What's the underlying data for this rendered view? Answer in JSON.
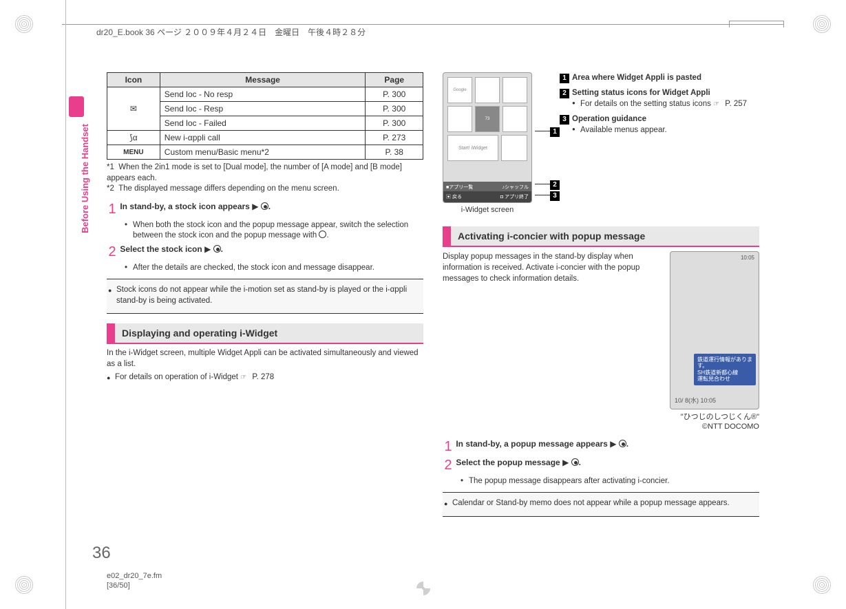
{
  "header": {
    "book_info": "dr20_E.book  36 ページ  ２００９年４月２４日　金曜日　午後４時２８分"
  },
  "side": {
    "tab_title": "Before Using the Handset"
  },
  "table": {
    "headers": {
      "icon": "Icon",
      "message": "Message",
      "page": "Page"
    },
    "rows": [
      {
        "icon": "✉",
        "message": "Send loc - No resp",
        "page": "P. 300"
      },
      {
        "icon": "",
        "message": "Send loc - Resp",
        "page": "P. 300"
      },
      {
        "icon": "",
        "message": "Send loc - Failed",
        "page": "P. 300"
      },
      {
        "icon": "⟆α",
        "message": "New i-αppli call",
        "page": "P. 273"
      },
      {
        "icon": "MENU",
        "message": "Custom menu/Basic menu*2",
        "page": "P. 38"
      }
    ]
  },
  "footnotes": {
    "f1_label": "*1",
    "f1_text": "When the 2in1 mode is set to [Dual mode], the number of [A mode] and [B mode] appears each.",
    "f2_label": "*2",
    "f2_text": "The displayed message differs depending on the menu screen."
  },
  "steps_a": {
    "s1": "In stand-by, a stock icon appears",
    "s1_end": ".",
    "s1_sub": "When both the stock icon and the popup message appear, switch the selection between the stock icon and the popup message with ",
    "s1_sub_end": ".",
    "s2": "Select the stock icon",
    "s2_end": ".",
    "s2_sub": "After the details are checked, the stock icon and message disappear."
  },
  "note_a": "Stock icons do not appear while the i-motion set as stand-by is played or the i-αppli stand-by is being activated.",
  "section_a": "Displaying and operating i-Widget",
  "section_a_body": {
    "p1": "In the i-Widget screen, multiple Widget Appli can be activated simultaneously and viewed as a list.",
    "b1_prefix": "For details on operation of i-Widget ",
    "b1_ref": "P. 278"
  },
  "iwidget_caption": "i-Widget screen",
  "callouts": {
    "c1_title": "Area where Widget Appli is pasted",
    "c2_title": "Setting status icons for Widget Appli",
    "c2_sub": "For details on the setting status icons ",
    "c2_ref": "P. 257",
    "c3_title": "Operation guidance",
    "c3_sub": "Available menus appear."
  },
  "section_b": "Activating i-concier with popup message",
  "section_b_body": {
    "p1": "Display popup messages in the stand-by display when information is received. Activate i-concier with the popup messages to check information details."
  },
  "phone2": {
    "popup_line1": "鉄道運行情報があります。",
    "popup_line2": "SH鉄道新都心線",
    "popup_line3": "運転見合わせ",
    "date": "10/ 8(水) 10:05"
  },
  "phone2_caption": {
    "l1": "\"ひつじのしつじくん®\"",
    "l2": "©NTT DOCOMO"
  },
  "steps_b": {
    "s1": "In stand-by, a popup message appears",
    "s1_end": ".",
    "s2": "Select the popup message",
    "s2_end": ".",
    "s2_sub": "The popup message disappears after activating i-concier."
  },
  "note_b": "Calendar or Stand-by memo does not appear while a popup message appears.",
  "page_number": "36",
  "footer": {
    "file": "e02_dr20_7e.fm",
    "loc": "[36/50]"
  },
  "phone1_bot": {
    "left1": "■アプリ一覧",
    "right1": "♪シャッフル",
    "left2": "▣ 戻る",
    "right2": "◘ アプリ終了"
  }
}
